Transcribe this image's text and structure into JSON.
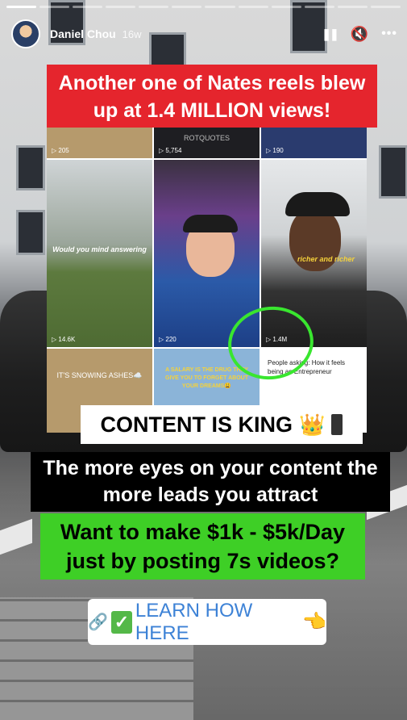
{
  "story": {
    "username": "Daniel Chou",
    "time_ago": "16w",
    "progress_total": 12,
    "progress_done": 1
  },
  "icons": {
    "pause": "❚❚",
    "mute": "🔇",
    "more": "•••"
  },
  "overlay": {
    "headline": "Another one of Nates reels blew up at 1.4 MILLION views!",
    "content_king": "CONTENT IS KING",
    "eyes": "The more eyes on your content the more leads you attract",
    "want": "Want to make $1k - $5k/Day just by posting 7s videos?",
    "cta_label": "LEARN HOW HERE"
  },
  "grid": {
    "tiles": [
      {
        "count": "▷ 205",
        "caption": ""
      },
      {
        "count": "▷ 5,754",
        "caption": "ROTQUOTES"
      },
      {
        "count": "▷ 190",
        "caption": ""
      },
      {
        "count": "▷ 14.6K",
        "caption": "Would you mind answering"
      },
      {
        "count": "▷ 220",
        "caption": ""
      },
      {
        "count": "▷ 1.4M",
        "caption": "richer and richer"
      },
      {
        "count": "",
        "caption": "IT'S SNOWING ASHES☁️"
      },
      {
        "count": "",
        "caption": "A SALARY IS THE DRUG THEY GIVE YOU TO FORGET ABOUT YOUR DREAMS😩"
      },
      {
        "count": "",
        "caption": "People asking: How it feels being an Entrepreneur"
      }
    ]
  },
  "colors": {
    "headline_bg": "#e5252d",
    "want_bg": "#3ecf26",
    "cta_text": "#3d82d6",
    "circle": "#39e62f"
  }
}
